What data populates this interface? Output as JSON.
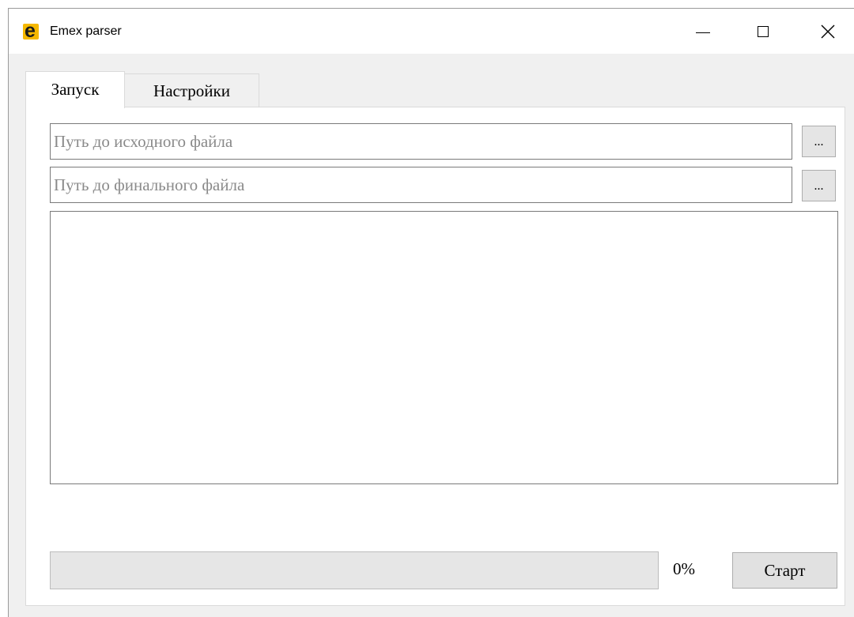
{
  "window": {
    "title": "Emex parser",
    "icon_letter": "e",
    "icon_color": "#f5b800"
  },
  "titlebar_buttons": {
    "minimize_icon": "minimize-icon",
    "maximize_icon": "maximize-icon",
    "close_icon": "close-icon"
  },
  "tabs": [
    {
      "label": "Запуск",
      "active": true
    },
    {
      "label": "Настройки",
      "active": false
    }
  ],
  "launch": {
    "source_path": {
      "value": "",
      "placeholder": "Путь до исходного файла"
    },
    "final_path": {
      "value": "",
      "placeholder": "Путь до финального файла"
    },
    "browse_label": "...",
    "log_text": "",
    "progress": {
      "value": 0,
      "label": "0%"
    },
    "start_label": "Старт"
  },
  "colors": {
    "progress_fill": "#06b025",
    "window_bg": "#f0f0f0"
  }
}
